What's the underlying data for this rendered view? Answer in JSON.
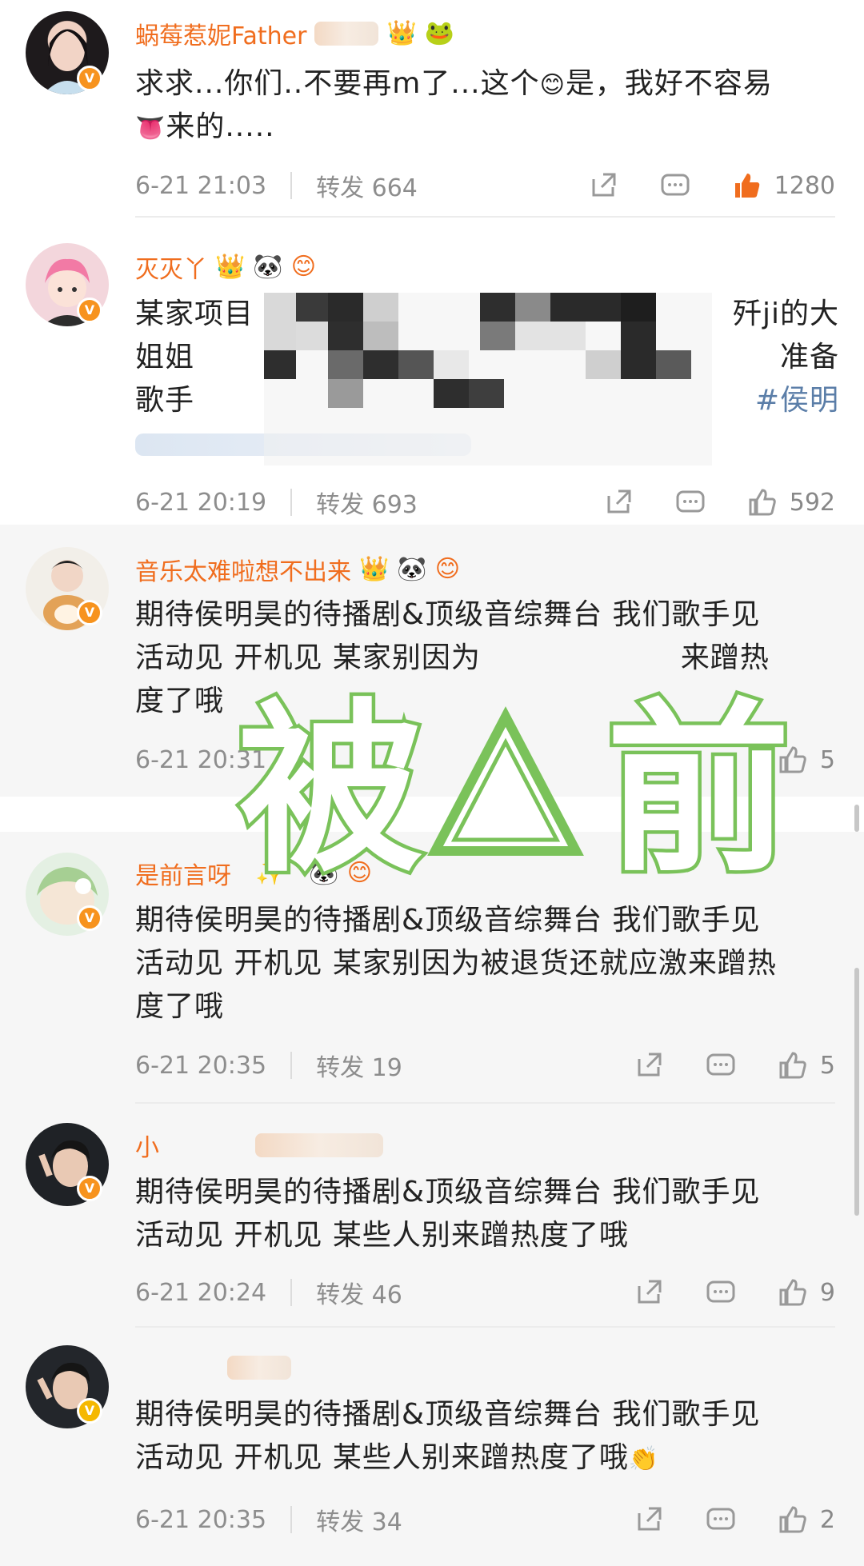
{
  "comments": [
    {
      "name": "蜗莓惹妮Father",
      "text_line1": "求求...你们..不要再m了...这个",
      "text_line1_end": "是，我好不容易",
      "text_line2": "来的.....",
      "date": "6-21 21:03",
      "repost": "转发 664",
      "likes": "1280"
    },
    {
      "name": "灭灭丫",
      "text_line1_start": "某家项目",
      "text_line1_end": "歼ji的大",
      "text_line2_start": "姐姐",
      "text_line2_end": "准备",
      "text_line3_start": "歌手",
      "text_line3_end": "#侯明",
      "date": "6-21 20:19",
      "repost": "转发 693",
      "likes": "592"
    },
    {
      "name": "音乐太难啦想不出来",
      "text_line1": "期待侯明昊的待播剧&顶级音综舞台 我们歌手见",
      "text_line2_start": "活动见 开机见 某家别因为",
      "text_line2_end": "来蹭热",
      "text_line3": "度了哦",
      "date": "6-21 20:31",
      "likes": "5"
    },
    {
      "name": "是前言呀",
      "text_line1": "期待侯明昊的待播剧&顶级音综舞台 我们歌手见",
      "text_line2": "活动见 开机见 某家别因为被退货还就应激来蹭热",
      "text_line3": "度了哦",
      "date": "6-21 20:35",
      "repost": "转发 19",
      "likes": "5"
    },
    {
      "name": "小",
      "text_line1": "期待侯明昊的待播剧&顶级音综舞台 我们歌手见",
      "text_line2": "活动见 开机见 某些人别来蹭热度了哦",
      "date": "6-21 20:24",
      "repost": "转发 46",
      "likes": "9"
    },
    {
      "name": "",
      "text_line1": "期待侯明昊的待播剧&顶级音综舞台 我们歌手见",
      "text_line2": "活动见 开机见 某些人别来蹭热度了哦",
      "date": "6-21 20:35",
      "repost": "转发 34",
      "likes": "2"
    }
  ],
  "watermark": {
    "text_left": "被",
    "text_right": "前",
    "color": "#7ac25a"
  },
  "colors": {
    "username": "#f06d1e",
    "meta": "#8d8d8d",
    "liked": "#f06d1e",
    "verified": "#f7931e"
  },
  "icons": [
    "repost-icon",
    "comment-icon",
    "like-icon"
  ]
}
